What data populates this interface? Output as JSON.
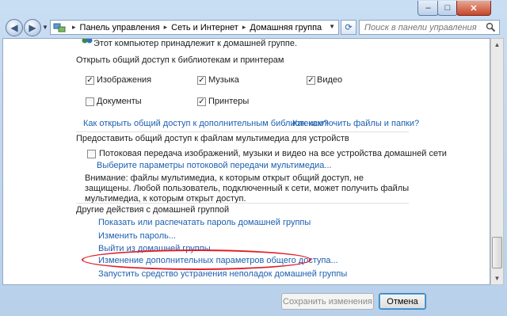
{
  "titlebar": {
    "minimize": "–",
    "maximize": "□",
    "close": "✕"
  },
  "address": {
    "crumbs": [
      "Панель управления",
      "Сеть и Интернет",
      "Домашняя группа"
    ]
  },
  "search": {
    "placeholder": "Поиск в панели управления"
  },
  "content": {
    "member_text": "Этот компьютер принадлежит к домашней группе.",
    "libraries": {
      "heading": "Открыть общий доступ к библиотекам и принтерам",
      "items": [
        {
          "label": "Изображения",
          "checked": true
        },
        {
          "label": "Музыка",
          "checked": true
        },
        {
          "label": "Видео",
          "checked": true
        },
        {
          "label": "Документы",
          "checked": false
        },
        {
          "label": "Принтеры",
          "checked": true
        }
      ],
      "link_more": "Как открыть общий доступ к дополнительным библиотекам?",
      "link_exclude": "Как исключить файлы и папки?"
    },
    "media": {
      "heading": "Предоставить общий доступ к файлам мультимедиа для устройств",
      "stream_label": "Потоковая передача изображений, музыки и видео на все устройства домашней сети",
      "stream_checked": false,
      "params_link": "Выберите параметры потоковой передачи мультимедиа...",
      "warning": "Внимание: файлы мультимедиа, к которым открыт общий доступ, не защищены. Любой пользователь, подключенный к сети, может получить файлы мультимедиа, к которым открыт доступ."
    },
    "other": {
      "heading": "Другие действия с домашней группой",
      "links": [
        "Показать или распечатать пароль домашней группы",
        "Изменить пароль...",
        "Выйти из домашней группы...",
        "Изменение дополнительных параметров общего доступа...",
        "Запустить средство устранения неполадок домашней группы"
      ]
    }
  },
  "footer": {
    "save": "Сохранить изменения",
    "cancel": "Отмена"
  },
  "colors": {
    "link": "#1c5fb0",
    "highlight_oval": "#e0202a"
  }
}
